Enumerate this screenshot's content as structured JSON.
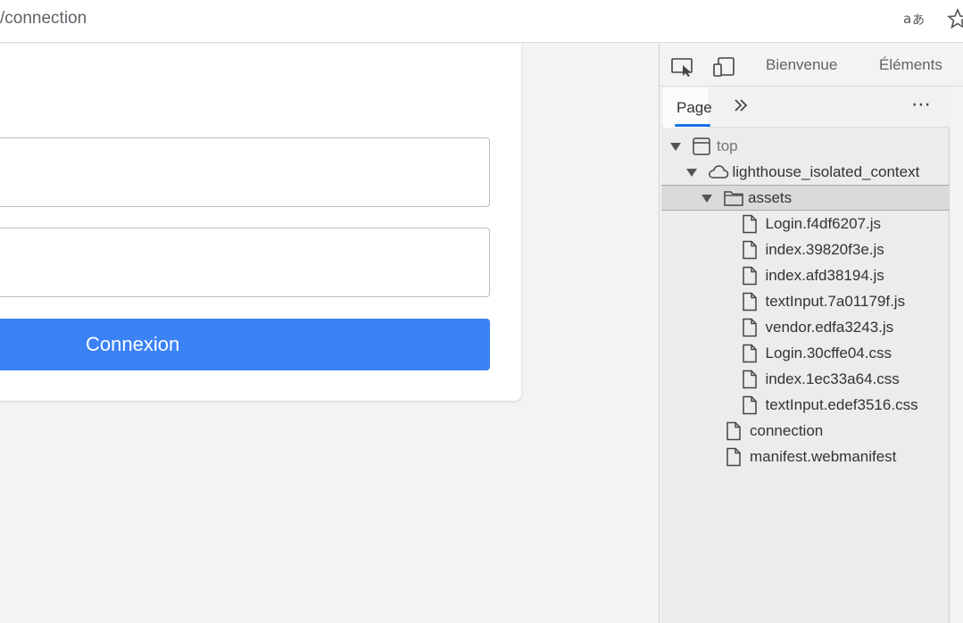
{
  "browser": {
    "url": "/connection",
    "translate_icon": "translate-icon",
    "favorite_icon": "star-icon"
  },
  "page": {
    "login_button_label": "Connexion"
  },
  "devtools": {
    "tabs": [
      "Bienvenue",
      "Éléments"
    ],
    "inspect_icon": "inspect-element-icon",
    "device_icon": "device-toolbar-icon",
    "sources": {
      "active_tab": "Page",
      "more_tabs_icon": "chevron-double-right-icon",
      "menu_icon": "more-options-icon",
      "menu_glyph": "⋯",
      "tree": [
        {
          "label": "top",
          "type": "frame",
          "depth": 0,
          "expanded": true
        },
        {
          "label": "lighthouse_isolated_context",
          "type": "cloud",
          "depth": 1,
          "expanded": true
        },
        {
          "label": "assets",
          "type": "folder",
          "depth": 2,
          "expanded": true,
          "selected": true
        },
        {
          "label": "Login.f4df6207.js",
          "type": "file",
          "depth": 3
        },
        {
          "label": "index.39820f3e.js",
          "type": "file",
          "depth": 3
        },
        {
          "label": "index.afd38194.js",
          "type": "file",
          "depth": 3
        },
        {
          "label": "textInput.7a01179f.js",
          "type": "file",
          "depth": 3
        },
        {
          "label": "vendor.edfa3243.js",
          "type": "file",
          "depth": 3
        },
        {
          "label": "Login.30cffe04.css",
          "type": "file",
          "depth": 3
        },
        {
          "label": "index.1ec33a64.css",
          "type": "file",
          "depth": 3
        },
        {
          "label": "textInput.edef3516.css",
          "type": "file",
          "depth": 3
        },
        {
          "label": "connection",
          "type": "file",
          "depth": 2
        },
        {
          "label": "manifest.webmanifest",
          "type": "file",
          "depth": 2
        }
      ]
    }
  }
}
